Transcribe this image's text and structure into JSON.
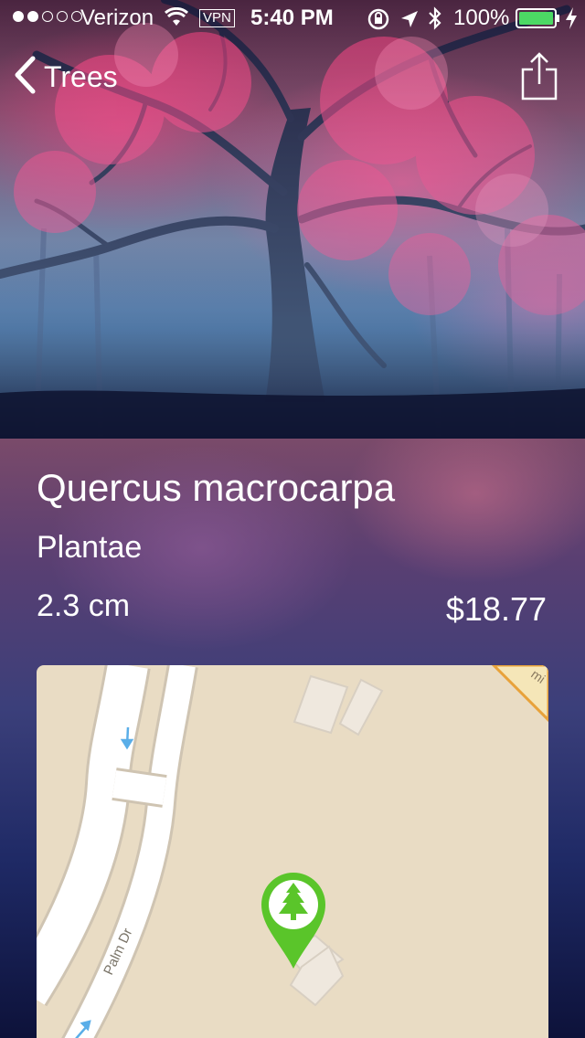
{
  "status_bar": {
    "carrier": "Verizon",
    "vpn": "VPN",
    "time": "5:40 PM",
    "battery": "100%"
  },
  "nav": {
    "back_label": "Trees"
  },
  "detail": {
    "name": "Quercus macrocarpa",
    "kingdom": "Plantae",
    "size": "2.3 cm",
    "price": "$18.77"
  },
  "map": {
    "street_label": "Palm Dr",
    "pin_icon": "tree-icon",
    "pin_color": "#5ac52a"
  },
  "icons": {
    "back": "chevron-left-icon",
    "share": "share-icon",
    "wifi": "wifi-icon",
    "lock": "orientation-lock-icon",
    "location": "location-arrow-icon",
    "bluetooth": "bluetooth-icon",
    "battery": "battery-icon",
    "charging": "charging-bolt-icon"
  }
}
